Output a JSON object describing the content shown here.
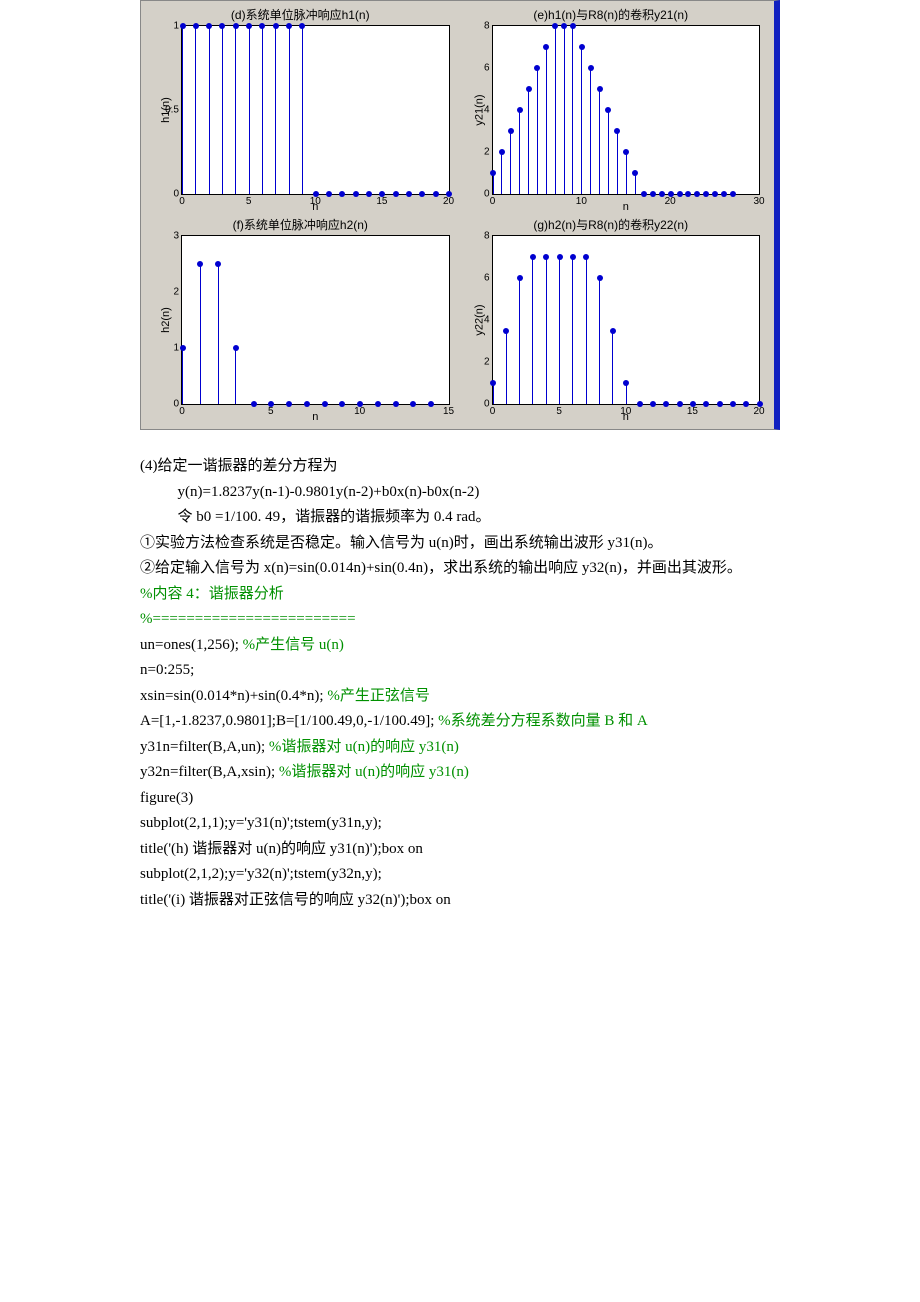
{
  "chart_data": [
    {
      "type": "stem",
      "title": "(d)系统单位脉冲响应h1(n)",
      "xlabel": "n",
      "ylabel": "h1(n)",
      "xlim": [
        0,
        20
      ],
      "ylim": [
        0,
        1
      ],
      "xticks": [
        0,
        5,
        10,
        15,
        20
      ],
      "yticks": [
        0,
        0.5,
        1
      ],
      "n": [
        0,
        1,
        2,
        3,
        4,
        5,
        6,
        7,
        8,
        9,
        10,
        11,
        12,
        13,
        14,
        15,
        16,
        17,
        18,
        19,
        20
      ],
      "values": [
        1,
        1,
        1,
        1,
        1,
        1,
        1,
        1,
        1,
        1,
        0,
        0,
        0,
        0,
        0,
        0,
        0,
        0,
        0,
        0,
        0
      ]
    },
    {
      "type": "stem",
      "title": "(e)h1(n)与R8(n)的卷积y21(n)",
      "xlabel": "n",
      "ylabel": "y21(n)",
      "xlim": [
        0,
        30
      ],
      "ylim": [
        0,
        8
      ],
      "xticks": [
        0,
        10,
        20,
        30
      ],
      "yticks": [
        0,
        2,
        4,
        6,
        8
      ],
      "n": [
        0,
        1,
        2,
        3,
        4,
        5,
        6,
        7,
        8,
        9,
        10,
        11,
        12,
        13,
        14,
        15,
        16,
        17,
        18,
        19,
        20,
        21,
        22,
        23,
        24,
        25,
        26,
        27
      ],
      "values": [
        1,
        2,
        3,
        4,
        5,
        6,
        7,
        8,
        8,
        8,
        7,
        6,
        5,
        4,
        3,
        2,
        1,
        0,
        0,
        0,
        0,
        0,
        0,
        0,
        0,
        0,
        0,
        0
      ]
    },
    {
      "type": "stem",
      "title": "(f)系统单位脉冲响应h2(n)",
      "xlabel": "n",
      "ylabel": "h2(n)",
      "xlim": [
        0,
        15
      ],
      "ylim": [
        0,
        3
      ],
      "xticks": [
        0,
        5,
        10,
        15
      ],
      "yticks": [
        0,
        1,
        2,
        3
      ],
      "n": [
        0,
        1,
        2,
        3,
        4,
        5,
        6,
        7,
        8,
        9,
        10,
        11,
        12,
        13,
        14
      ],
      "values": [
        1,
        2.5,
        2.5,
        1,
        0,
        0,
        0,
        0,
        0,
        0,
        0,
        0,
        0,
        0,
        0
      ]
    },
    {
      "type": "stem",
      "title": "(g)h2(n)与R8(n)的卷积y22(n)",
      "xlabel": "n",
      "ylabel": "y22(n)",
      "xlim": [
        0,
        20
      ],
      "ylim": [
        0,
        8
      ],
      "xticks": [
        0,
        5,
        10,
        15,
        20
      ],
      "yticks": [
        0,
        2,
        4,
        6,
        8
      ],
      "n": [
        0,
        1,
        2,
        3,
        4,
        5,
        6,
        7,
        8,
        9,
        10,
        11,
        12,
        13,
        14,
        15,
        16,
        17,
        18,
        19,
        20
      ],
      "values": [
        1,
        3.5,
        6,
        7,
        7,
        7,
        7,
        7,
        6,
        3.5,
        1,
        0,
        0,
        0,
        0,
        0,
        0,
        0,
        0,
        0,
        0
      ]
    }
  ],
  "text": {
    "q4": "(4)给定一谐振器的差分方程为",
    "eq1": "y(n)=1.8237y(n-1)-0.9801y(n-2)+b0x(n)-b0x(n-2)",
    "eq2": "令 b0 =1/100. 49，谐振器的谐振频率为 0.4 rad。",
    "p1": "①实验方法检查系统是否稳定。输入信号为 u(n)时，画出系统输出波形 y31(n)。",
    "p2": "②给定输入信号为 x(n)=sin(0.014n)+sin(0.4n)，求出系统的输出响应 y32(n)，并画出其波形。",
    "c1": "%内容 4：谐振器分析",
    "c2": "%========================",
    "c3a": "un=ones(1,256);   ",
    "c3b": "%产生信号 u(n)",
    "c4": "n=0:255;",
    "c5a": "xsin=sin(0.014*n)+sin(0.4*n); ",
    "c5b": "%产生正弦信号",
    "c6a": "A=[1,-1.8237,0.9801];B=[1/100.49,0,-1/100.49]; ",
    "c6b": "%系统差分方程系数向量 B 和 A",
    "c7a": "y31n=filter(B,A,un);    ",
    "c7b": "%谐振器对 u(n)的响应 y31(n)",
    "c8a": "y32n=filter(B,A,xsin);    ",
    "c8b": "%谐振器对 u(n)的响应 y31(n)",
    "c9": "figure(3)",
    "c10": "subplot(2,1,1);y='y31(n)';tstem(y31n,y);",
    "c11": "title('(h)  谐振器对 u(n)的响应 y31(n)');box on",
    "c12": "subplot(2,1,2);y='y32(n)';tstem(y32n,y);",
    "c13": "title('(i)  谐振器对正弦信号的响应 y32(n)');box on"
  }
}
